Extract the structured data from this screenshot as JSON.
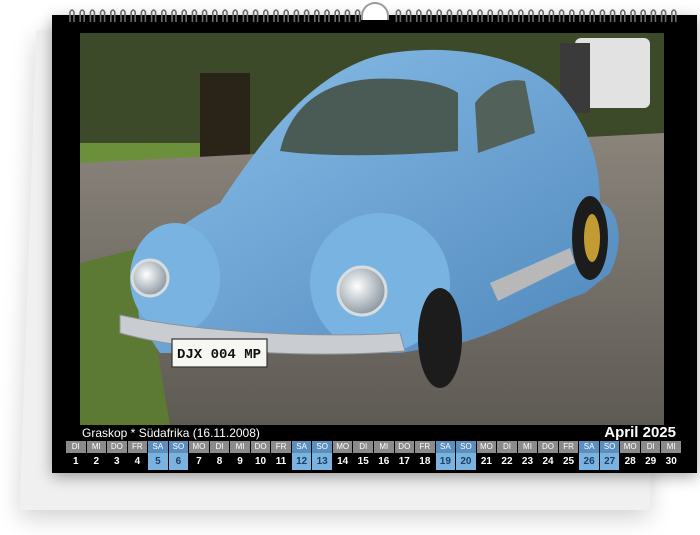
{
  "calendar": {
    "caption": "Graskop * Südafrika (16.11.2008)",
    "month_label": "April 2025",
    "days": [
      {
        "name": "DI",
        "num": "1",
        "weekend": false
      },
      {
        "name": "MI",
        "num": "2",
        "weekend": false
      },
      {
        "name": "DO",
        "num": "3",
        "weekend": false
      },
      {
        "name": "FR",
        "num": "4",
        "weekend": false
      },
      {
        "name": "SA",
        "num": "5",
        "weekend": true
      },
      {
        "name": "SO",
        "num": "6",
        "weekend": true
      },
      {
        "name": "MO",
        "num": "7",
        "weekend": false
      },
      {
        "name": "DI",
        "num": "8",
        "weekend": false
      },
      {
        "name": "MI",
        "num": "9",
        "weekend": false
      },
      {
        "name": "DO",
        "num": "10",
        "weekend": false
      },
      {
        "name": "FR",
        "num": "11",
        "weekend": false
      },
      {
        "name": "SA",
        "num": "12",
        "weekend": true
      },
      {
        "name": "SO",
        "num": "13",
        "weekend": true
      },
      {
        "name": "MO",
        "num": "14",
        "weekend": false
      },
      {
        "name": "DI",
        "num": "15",
        "weekend": false
      },
      {
        "name": "MI",
        "num": "16",
        "weekend": false
      },
      {
        "name": "DO",
        "num": "17",
        "weekend": false
      },
      {
        "name": "FR",
        "num": "18",
        "weekend": false
      },
      {
        "name": "SA",
        "num": "19",
        "weekend": true
      },
      {
        "name": "SO",
        "num": "20",
        "weekend": true
      },
      {
        "name": "MO",
        "num": "21",
        "weekend": false
      },
      {
        "name": "DI",
        "num": "22",
        "weekend": false
      },
      {
        "name": "MI",
        "num": "23",
        "weekend": false
      },
      {
        "name": "DO",
        "num": "24",
        "weekend": false
      },
      {
        "name": "FR",
        "num": "25",
        "weekend": false
      },
      {
        "name": "SA",
        "num": "26",
        "weekend": true
      },
      {
        "name": "SO",
        "num": "27",
        "weekend": true
      },
      {
        "name": "MO",
        "num": "28",
        "weekend": false
      },
      {
        "name": "DI",
        "num": "29",
        "weekend": false
      },
      {
        "name": "MI",
        "num": "30",
        "weekend": false
      }
    ]
  },
  "photo": {
    "plate_text": "DJX 004 MP"
  },
  "colors": {
    "car_blue": "#6fa7d6",
    "weekend_bg": "#7ab3e0"
  }
}
